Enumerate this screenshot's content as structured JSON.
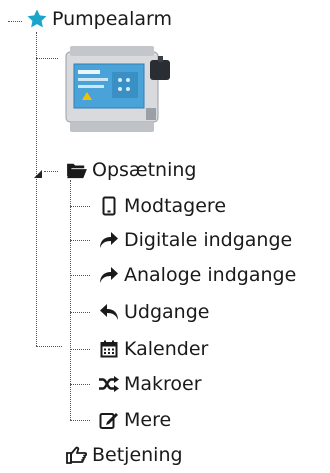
{
  "tree": {
    "root": {
      "label": "Pumpealarm",
      "icon": "star-icon",
      "icon_color": "#1aa6c9"
    },
    "device_image": {
      "icon": "alarm-device-image"
    },
    "setup": {
      "label": "Opsætning",
      "icon": "folder-open-icon",
      "children": [
        {
          "label": "Modtagere",
          "icon": "mobile-phone-icon"
        },
        {
          "label": "Digitale indgange",
          "icon": "share-arrow-icon"
        },
        {
          "label": "Analoge indgange",
          "icon": "share-arrow-icon"
        },
        {
          "label": "Udgange",
          "icon": "reply-arrow-icon"
        },
        {
          "label": "Kalender",
          "icon": "calendar-icon"
        },
        {
          "label": "Makroer",
          "icon": "shuffle-icon"
        },
        {
          "label": "Mere",
          "icon": "edit-icon"
        }
      ]
    },
    "operation": {
      "label": "Betjening",
      "icon": "hand-pointing-icon"
    }
  },
  "colors": {
    "accent": "#1aa6c9",
    "text": "#1a1a1a",
    "tree_line": "#555555"
  }
}
